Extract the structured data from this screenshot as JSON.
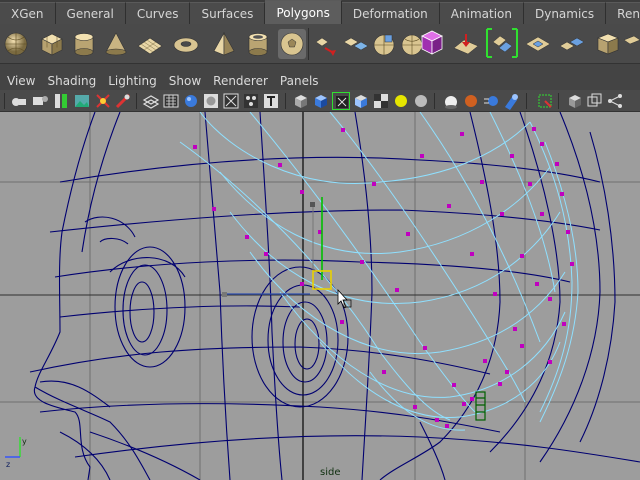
{
  "shelf": {
    "tabs": [
      {
        "label": "XGen",
        "active": false
      },
      {
        "label": "General",
        "active": false
      },
      {
        "label": "Curves",
        "active": false
      },
      {
        "label": "Surfaces",
        "active": false
      },
      {
        "label": "Polygons",
        "active": true
      },
      {
        "label": "Deformation",
        "active": false
      },
      {
        "label": "Animation",
        "active": false
      },
      {
        "label": "Dynamics",
        "active": false
      },
      {
        "label": "Render",
        "active": false
      }
    ],
    "tools": [
      "poly-sphere-icon",
      "poly-cube-icon",
      "poly-cylinder-icon",
      "poly-cone-icon",
      "poly-plane-icon",
      "poly-torus-icon",
      "poly-pyramid-icon",
      "poly-pipe-icon",
      "poly-soccer-ball-icon",
      "poly-separate-icon",
      "poly-combine-icon",
      "poly-extract-icon",
      "poly-smooth-icon",
      "poly-cube-purple-icon",
      "poly-sculpt-icon",
      "poly-bridge-icon",
      "poly-fill-hole-icon",
      "poly-append-icon",
      "poly-plane-cut-icon",
      "poly-mirror-icon"
    ]
  },
  "panel": {
    "menus": [
      "View",
      "Shading",
      "Lighting",
      "Show",
      "Renderer",
      "Panels"
    ]
  },
  "viewport": {
    "camera_label": "side",
    "colors": {
      "background": "#9d9d9d",
      "wire_main": "#000070",
      "wire_selected": "#8fe0ff",
      "vertex": "#c000c0",
      "manipulator_y": "#00c000",
      "manipulator_select": "#e8d000"
    }
  }
}
